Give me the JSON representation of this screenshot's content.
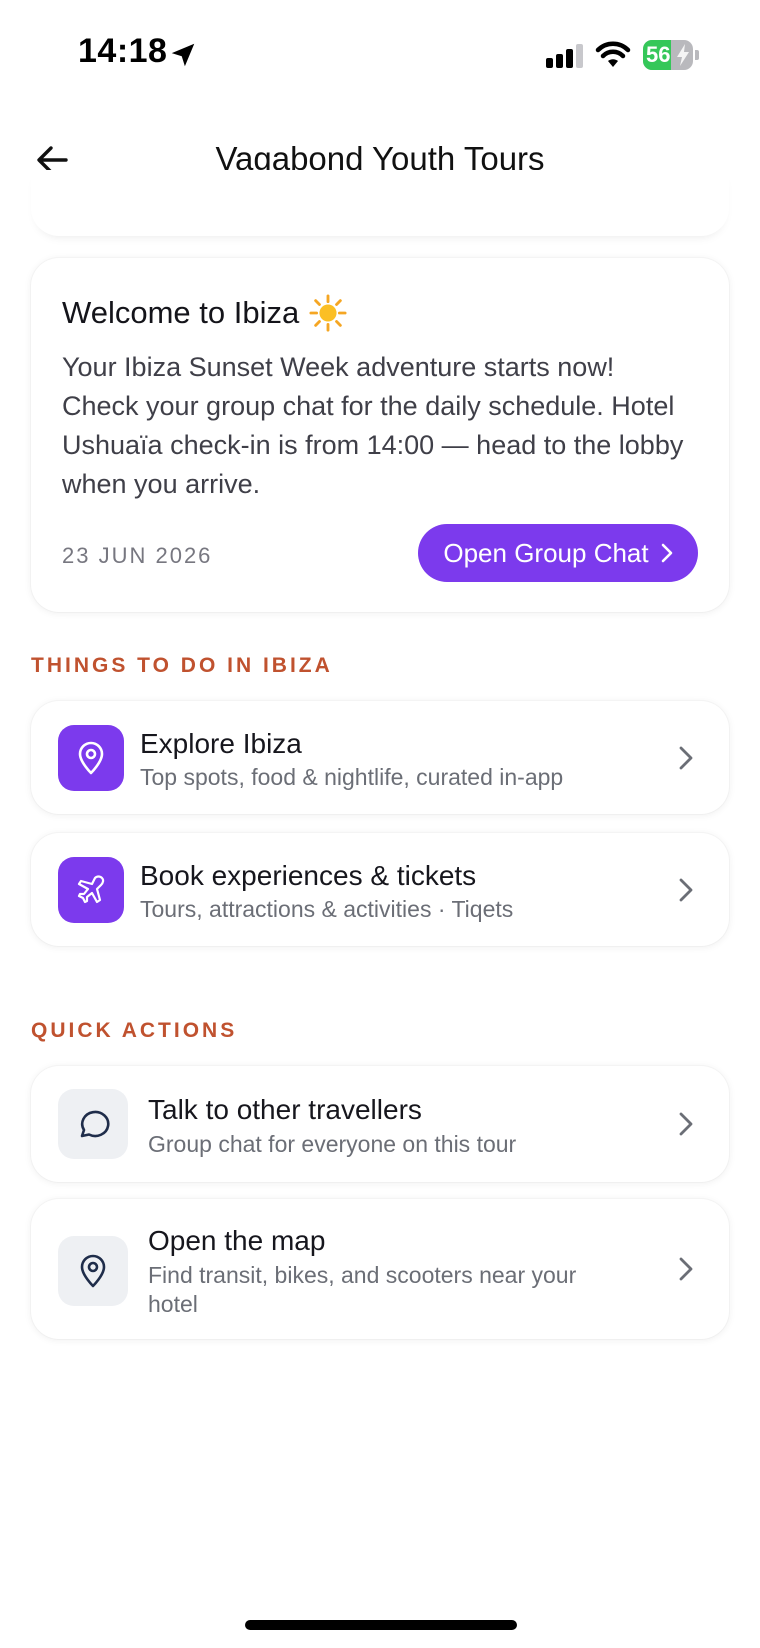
{
  "status": {
    "time": "14:18",
    "battery": "56",
    "battery_level": 0.56
  },
  "nav": {
    "title": "Vagabond Youth Tours"
  },
  "welcome": {
    "title": "Welcome to Ibiza",
    "emoji_icon": "sun-icon",
    "body": "Your Ibiza Sunset Week adventure starts now! Check your group chat for the daily schedule. Hotel Ushuaïa check-in is from 14:00 — head to the lobby when you arrive.",
    "date": "23 JUN 2026",
    "button_label": "Open Group Chat"
  },
  "things_to_do": {
    "label": "THINGS TO DO IN IBIZA",
    "items": [
      {
        "title": "Explore Ibiza",
        "subtitle": "Top spots, food & nightlife, curated in-app",
        "icon": "map-pin-icon"
      },
      {
        "title": "Book experiences & tickets",
        "subtitle": "Tours, attractions & activities · Tiqets",
        "icon": "plane-icon"
      }
    ]
  },
  "quick_actions": {
    "label": "QUICK ACTIONS",
    "items": [
      {
        "title": "Talk to other travellers",
        "subtitle": "Group chat for everyone on this tour",
        "icon": "chat-bubble-icon"
      },
      {
        "title": "Open the map",
        "subtitle": "Find transit, bikes, and scooters near your hotel",
        "icon": "map-pin-icon"
      }
    ]
  },
  "colors": {
    "accent": "#7c3aed",
    "section_label": "#c0522f",
    "battery_green": "#35c759"
  }
}
